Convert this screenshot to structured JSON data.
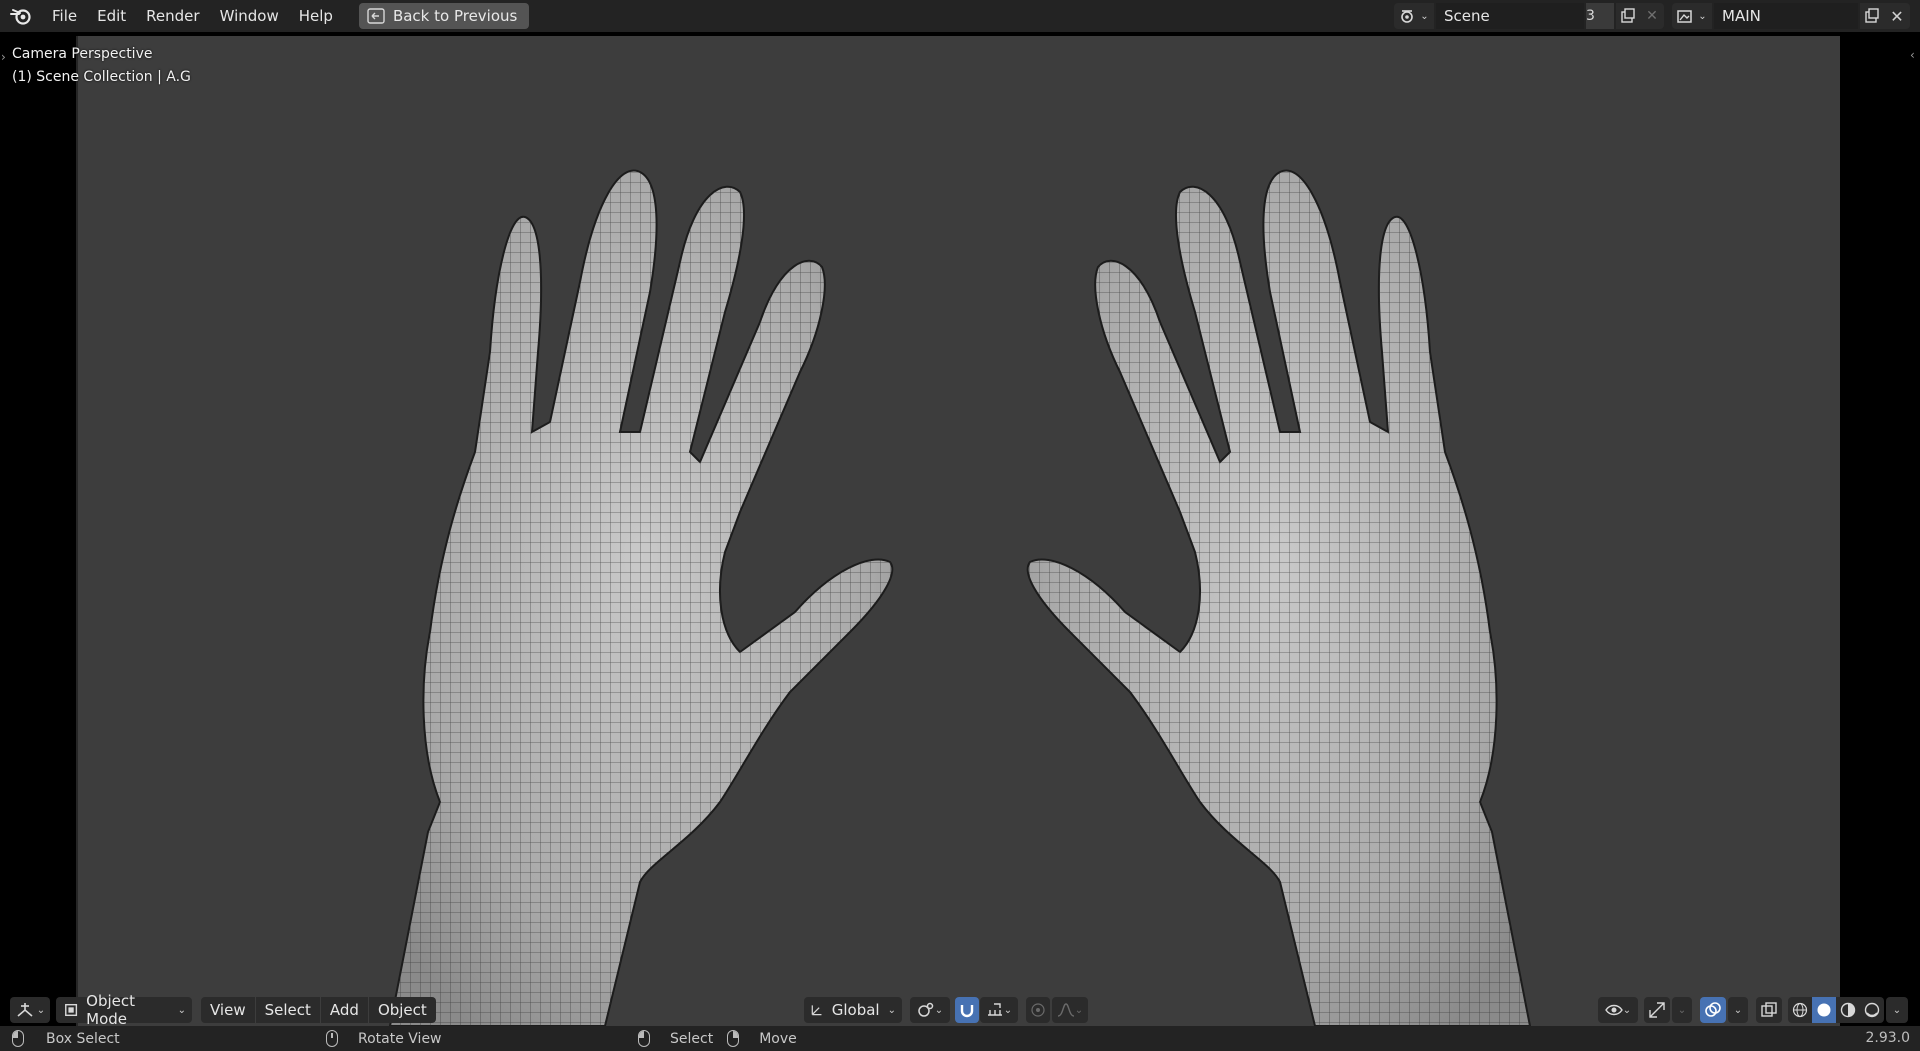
{
  "topbar": {
    "menu": [
      "File",
      "Edit",
      "Render",
      "Window",
      "Help"
    ],
    "back_button": "Back to Previous",
    "scene": {
      "name": "Scene",
      "users": "3"
    },
    "view_layer": {
      "name": "MAIN"
    }
  },
  "viewport": {
    "overlay_line1": "Camera Perspective",
    "overlay_line2": "(1) Scene Collection | A.G"
  },
  "header": {
    "mode": "Object Mode",
    "menus": [
      "View",
      "Select",
      "Add",
      "Object"
    ],
    "orientation": "Global"
  },
  "statusbar": {
    "left_action": "Box Select",
    "middle_action": "Rotate View",
    "right_action_1": "Select",
    "right_action_2": "Move",
    "version": "2.93.0"
  },
  "colors": {
    "viewport_bg": "#3d3d3d",
    "accent": "#4772b3",
    "header_bg": "#232323"
  }
}
